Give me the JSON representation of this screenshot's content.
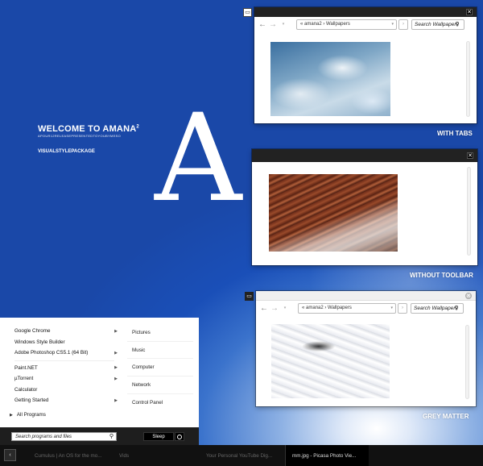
{
  "desktop": {
    "welcome_title": "WELCOME TO AMANA",
    "welcome_sup": "2",
    "welcome_sub": "APOUR12RELEASEPRESENTEDTOYOUBYMESO",
    "pack_label": "VISUALSTYLEPACKAGE",
    "big_letter": "A"
  },
  "windows": [
    {
      "label": "WITH TABS",
      "address_user": "amana2",
      "address_folder": "Wallpapers",
      "address_prefix": "«",
      "sep": "›",
      "search_placeholder": "Search Wallpapers"
    },
    {
      "label": "WITHOUT TOOLBAR"
    },
    {
      "label": "GREY MATTER",
      "address_user": "amana2",
      "address_folder": "Wallpapers",
      "address_prefix": "«",
      "sep": "›",
      "search_placeholder": "Search Wallpapers"
    }
  ],
  "start_menu": {
    "programs": [
      {
        "label": "Google Chrome",
        "has_arrow": true
      },
      {
        "label": "Windows Style Builder",
        "has_arrow": false
      },
      {
        "label": "Adobe Photoshop CS5.1 (64 Bit)",
        "has_arrow": true
      },
      {
        "label": "Paint.NET",
        "has_arrow": true
      },
      {
        "label": "µTorrent",
        "has_arrow": true
      },
      {
        "label": "Calculator",
        "has_arrow": false
      },
      {
        "label": "Getting Started",
        "has_arrow": true
      }
    ],
    "all_programs": "All Programs",
    "places": [
      "Pictures",
      "Music",
      "Computer",
      "Network",
      "Control Panel"
    ],
    "search_placeholder": "Search programs and files",
    "sleep_label": "Sleep"
  },
  "taskbar": {
    "items": [
      {
        "label": "Cumulus | An OS for the mo...",
        "active": false
      },
      {
        "label": "Vids",
        "active": false
      },
      {
        "label": "Your Personal YouTube Dig...",
        "active": false
      },
      {
        "label": "mm.jpg - Picasa Photo Vie...",
        "active": true
      }
    ]
  },
  "icons": {
    "back": "arrow-left-icon",
    "forward": "arrow-right-icon",
    "search": "magnifier-icon",
    "close": "close-icon",
    "power": "power-icon"
  }
}
